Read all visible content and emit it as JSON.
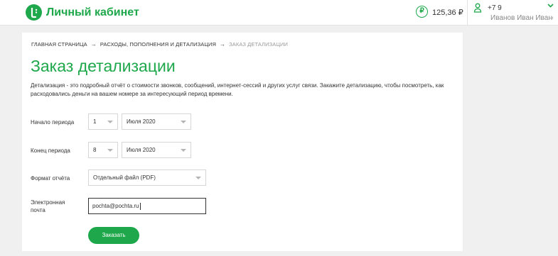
{
  "header": {
    "app_title": "Личный кабинет",
    "balance": "125,36 ₽",
    "balance_icon": "ruble-icon",
    "phone": "+7 9",
    "user_name": "Иванов Иван Иванов...",
    "colors": {
      "brand": "#1ea84b"
    }
  },
  "breadcrumb": {
    "items": [
      "ГЛАВНАЯ СТРАНИЦА",
      "РАСХОДЫ, ПОПОЛНЕНИЯ И ДЕТАЛИЗАЦИЯ",
      "ЗАКАЗ ДЕТАЛИЗАЦИИ"
    ],
    "separator": "→"
  },
  "page": {
    "title": "Заказ детализации",
    "description": "Детализация - это подробный отчёт о стоимости звонков, сообщений, интернет-сессий и других услуг связи. Закажите детализацию, чтобы посмотреть, как расходовались деньги на вашем номере за интересующий период времени."
  },
  "form": {
    "period_start": {
      "label": "Начало периода",
      "day": "1",
      "month": "Июля 2020"
    },
    "period_end": {
      "label": "Конец периода",
      "day": "8",
      "month": "Июля 2020"
    },
    "format": {
      "label": "Формат отчёта",
      "value": "Отдельный файл (PDF)"
    },
    "email": {
      "label": "Электронная почта",
      "value": "pochta@pochta.ru"
    },
    "submit_label": "Заказать"
  }
}
